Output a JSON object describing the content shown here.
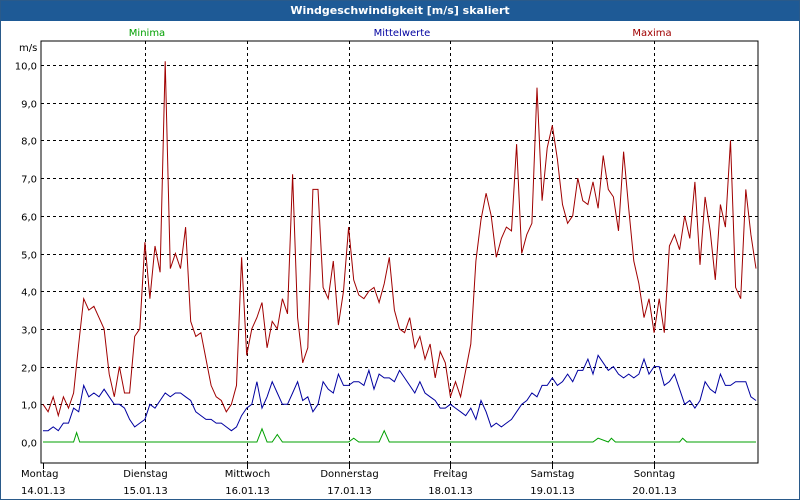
{
  "window": {
    "title": "Windgeschwindigkeit [m/s] skaliert"
  },
  "chart_data": {
    "type": "line",
    "title": "Windgeschwindigkeit [m/s] skaliert",
    "ylabel": "m/s",
    "ylim": [
      0,
      10.5
    ],
    "yticks": [
      "0,0",
      "1,0",
      "2,0",
      "3,0",
      "4,0",
      "5,0",
      "6,0",
      "7,0",
      "8,0",
      "9,0",
      "10,0"
    ],
    "xlim": [
      0,
      7
    ],
    "days": [
      {
        "name": "Montag",
        "date": "14.01.13"
      },
      {
        "name": "Dienstag",
        "date": "15.01.13"
      },
      {
        "name": "Mittwoch",
        "date": "16.01.13"
      },
      {
        "name": "Donnerstag",
        "date": "17.01.13"
      },
      {
        "name": "Freitag",
        "date": "18.01.13"
      },
      {
        "name": "Samstag",
        "date": "19.01.13"
      },
      {
        "name": "Sonntag",
        "date": "20.01.13"
      }
    ],
    "grid": true,
    "legend_position": "top",
    "series": [
      {
        "name": "Minima",
        "color": "#00a000",
        "x": [
          0,
          0.3,
          0.33,
          0.36,
          2.1,
          2.15,
          2.2,
          2.25,
          2.3,
          2.35,
          3.0,
          3.05,
          3.1,
          3.3,
          3.35,
          3.4,
          5.4,
          5.45,
          5.55,
          5.58,
          5.62,
          6.25,
          6.28,
          6.32,
          7.0
        ],
        "y": [
          0,
          0,
          0.25,
          0,
          0,
          0.35,
          0,
          0,
          0.2,
          0,
          0,
          0.1,
          0,
          0,
          0.3,
          0,
          0,
          0.1,
          0,
          0.1,
          0,
          0,
          0.1,
          0,
          0
        ]
      },
      {
        "name": "Mittelwerte",
        "color": "#0000a0",
        "x": [
          0,
          0.05,
          0.1,
          0.15,
          0.2,
          0.25,
          0.3,
          0.35,
          0.4,
          0.45,
          0.5,
          0.55,
          0.6,
          0.65,
          0.7,
          0.75,
          0.8,
          0.85,
          0.9,
          0.95,
          1.0,
          1.05,
          1.1,
          1.15,
          1.2,
          1.25,
          1.3,
          1.35,
          1.4,
          1.45,
          1.5,
          1.55,
          1.6,
          1.65,
          1.7,
          1.75,
          1.8,
          1.85,
          1.9,
          1.95,
          2.0,
          2.05,
          2.1,
          2.15,
          2.2,
          2.25,
          2.3,
          2.35,
          2.4,
          2.45,
          2.5,
          2.55,
          2.6,
          2.65,
          2.7,
          2.75,
          2.8,
          2.85,
          2.9,
          2.95,
          3.0,
          3.05,
          3.1,
          3.15,
          3.2,
          3.25,
          3.3,
          3.35,
          3.4,
          3.45,
          3.5,
          3.55,
          3.6,
          3.65,
          3.7,
          3.75,
          3.8,
          3.85,
          3.9,
          3.95,
          4.0,
          4.05,
          4.1,
          4.15,
          4.2,
          4.25,
          4.3,
          4.35,
          4.4,
          4.45,
          4.5,
          4.55,
          4.6,
          4.65,
          4.7,
          4.75,
          4.8,
          4.85,
          4.9,
          4.95,
          5.0,
          5.05,
          5.1,
          5.15,
          5.2,
          5.25,
          5.3,
          5.35,
          5.4,
          5.45,
          5.5,
          5.55,
          5.6,
          5.65,
          5.7,
          5.75,
          5.8,
          5.85,
          5.9,
          5.95,
          6.0,
          6.05,
          6.1,
          6.15,
          6.2,
          6.25,
          6.3,
          6.35,
          6.4,
          6.45,
          6.5,
          6.55,
          6.6,
          6.65,
          6.7,
          6.75,
          6.8,
          6.85,
          6.9,
          6.95,
          7.0
        ],
        "y": [
          0.3,
          0.3,
          0.4,
          0.3,
          0.5,
          0.5,
          0.9,
          0.8,
          1.5,
          1.2,
          1.3,
          1.2,
          1.4,
          1.2,
          1.0,
          1.0,
          0.9,
          0.6,
          0.4,
          0.5,
          0.6,
          1.0,
          0.9,
          1.1,
          1.3,
          1.2,
          1.3,
          1.3,
          1.2,
          1.1,
          0.8,
          0.7,
          0.6,
          0.6,
          0.5,
          0.5,
          0.4,
          0.3,
          0.4,
          0.7,
          0.9,
          1.0,
          1.6,
          0.9,
          1.2,
          1.6,
          1.3,
          1.0,
          1.0,
          1.3,
          1.6,
          1.1,
          1.2,
          0.8,
          1.0,
          1.6,
          1.4,
          1.3,
          1.8,
          1.5,
          1.5,
          1.6,
          1.6,
          1.5,
          1.9,
          1.4,
          1.8,
          1.7,
          1.7,
          1.6,
          1.9,
          1.7,
          1.5,
          1.3,
          1.6,
          1.3,
          1.2,
          1.1,
          0.9,
          0.9,
          1.0,
          0.9,
          0.8,
          0.7,
          0.9,
          0.6,
          1.1,
          0.8,
          0.4,
          0.5,
          0.4,
          0.5,
          0.6,
          0.8,
          1.0,
          1.1,
          1.3,
          1.2,
          1.5,
          1.5,
          1.7,
          1.5,
          1.6,
          1.8,
          1.6,
          1.9,
          1.9,
          2.2,
          1.8,
          2.3,
          2.1,
          1.9,
          2.0,
          1.8,
          1.7,
          1.8,
          1.7,
          1.8,
          2.2,
          1.8,
          2.0,
          2.0,
          1.5,
          1.6,
          1.8,
          1.4,
          1.0,
          1.1,
          0.9,
          1.1,
          1.6,
          1.4,
          1.3,
          1.8,
          1.5,
          1.5,
          1.6,
          1.6,
          1.6,
          1.2,
          1.1
        ]
      },
      {
        "name": "Maxima",
        "color": "#a00000",
        "x": [
          0,
          0.05,
          0.1,
          0.15,
          0.2,
          0.25,
          0.3,
          0.35,
          0.4,
          0.45,
          0.5,
          0.55,
          0.6,
          0.65,
          0.7,
          0.75,
          0.8,
          0.85,
          0.9,
          0.95,
          1.0,
          1.05,
          1.1,
          1.15,
          1.2,
          1.25,
          1.3,
          1.35,
          1.4,
          1.45,
          1.5,
          1.55,
          1.6,
          1.65,
          1.7,
          1.75,
          1.8,
          1.85,
          1.9,
          1.95,
          2.0,
          2.05,
          2.1,
          2.15,
          2.2,
          2.25,
          2.3,
          2.35,
          2.4,
          2.45,
          2.5,
          2.55,
          2.6,
          2.65,
          2.7,
          2.75,
          2.8,
          2.85,
          2.9,
          2.95,
          3.0,
          3.05,
          3.1,
          3.15,
          3.2,
          3.25,
          3.3,
          3.35,
          3.4,
          3.45,
          3.5,
          3.55,
          3.6,
          3.65,
          3.7,
          3.75,
          3.8,
          3.85,
          3.9,
          3.95,
          4.0,
          4.05,
          4.1,
          4.15,
          4.2,
          4.25,
          4.3,
          4.35,
          4.4,
          4.45,
          4.5,
          4.55,
          4.6,
          4.65,
          4.7,
          4.75,
          4.8,
          4.85,
          4.9,
          4.95,
          5.0,
          5.05,
          5.1,
          5.15,
          5.2,
          5.25,
          5.3,
          5.35,
          5.4,
          5.45,
          5.5,
          5.55,
          5.6,
          5.65,
          5.7,
          5.75,
          5.8,
          5.85,
          5.9,
          5.95,
          6.0,
          6.05,
          6.1,
          6.15,
          6.2,
          6.25,
          6.3,
          6.35,
          6.4,
          6.45,
          6.5,
          6.55,
          6.6,
          6.65,
          6.7,
          6.75,
          6.8,
          6.85,
          6.9,
          6.95,
          7.0
        ],
        "y": [
          1.0,
          0.8,
          1.2,
          0.7,
          1.2,
          0.9,
          1.3,
          2.6,
          3.8,
          3.5,
          3.6,
          3.3,
          3.0,
          1.8,
          1.2,
          2.0,
          1.3,
          1.3,
          2.8,
          3.0,
          5.3,
          3.8,
          5.2,
          4.5,
          10.1,
          4.6,
          5.0,
          4.6,
          5.7,
          3.2,
          2.8,
          2.9,
          2.2,
          1.5,
          1.2,
          1.1,
          0.8,
          1.0,
          1.5,
          4.9,
          2.3,
          3.0,
          3.3,
          3.7,
          2.5,
          3.2,
          3.0,
          3.8,
          3.4,
          7.1,
          3.3,
          2.1,
          2.5,
          6.7,
          6.7,
          4.1,
          3.8,
          4.8,
          3.1,
          4.0,
          5.7,
          4.3,
          3.9,
          3.8,
          4.0,
          4.1,
          3.7,
          4.2,
          4.9,
          3.5,
          3.0,
          2.9,
          3.3,
          2.5,
          2.8,
          2.2,
          2.6,
          1.7,
          2.4,
          2.1,
          1.2,
          1.6,
          1.2,
          1.9,
          2.6,
          4.8,
          5.9,
          6.6,
          6.0,
          4.9,
          5.4,
          5.7,
          5.6,
          7.9,
          5.0,
          5.5,
          5.8,
          9.4,
          6.4,
          7.8,
          8.4,
          7.5,
          6.3,
          5.8,
          6.0,
          7.0,
          6.4,
          6.3,
          6.9,
          6.2,
          7.6,
          6.7,
          6.5,
          5.6,
          7.7,
          6.2,
          4.8,
          4.2,
          3.3,
          3.8,
          2.9,
          3.8,
          2.9,
          5.2,
          5.5,
          5.1,
          6.0,
          5.4,
          6.9,
          4.7,
          6.5,
          5.6,
          4.3,
          6.3,
          5.7,
          8.0,
          4.1,
          3.8,
          6.7,
          5.5,
          4.6
        ]
      }
    ]
  }
}
